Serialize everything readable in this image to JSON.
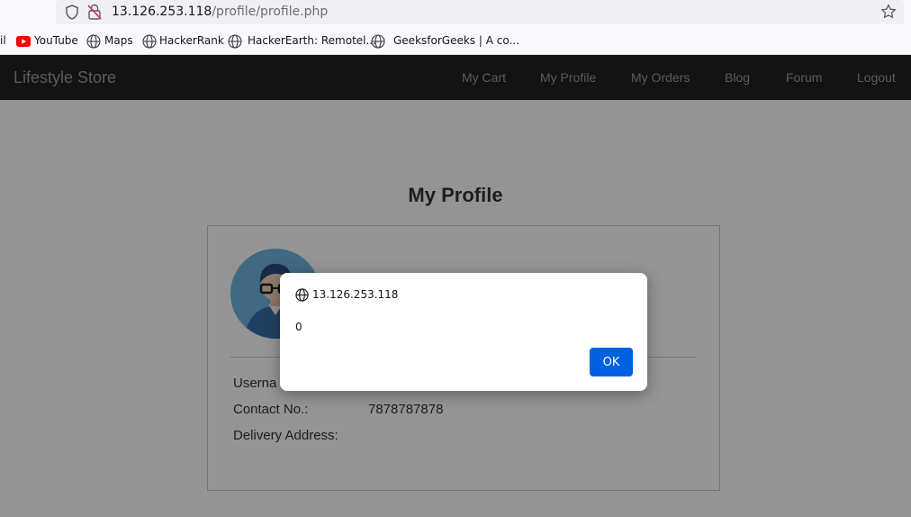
{
  "browser": {
    "url_host": "13.126.253.118",
    "url_path": "/profile/profile.php",
    "bookmarks": [
      {
        "label": "il",
        "icon": "gmail-icon"
      },
      {
        "label": "YouTube",
        "icon": "youtube-icon"
      },
      {
        "label": "Maps",
        "icon": "globe-icon"
      },
      {
        "label": "HackerRank",
        "icon": "globe-icon"
      },
      {
        "label": "HackerEarth: Remotel...",
        "icon": "globe-icon"
      },
      {
        "label": "GeeksforGeeks | A co...",
        "icon": "globe-icon"
      }
    ],
    "youtube_color": "#ff0000"
  },
  "site": {
    "brand": "Lifestyle Store",
    "nav": [
      "My Cart",
      "My Profile",
      "My Orders",
      "Blog",
      "Forum",
      "Logout"
    ]
  },
  "profile": {
    "title": "My Profile",
    "username_label": "Userna",
    "contact_label": "Contact No.:",
    "contact_value": "7878787878",
    "address_label": "Delivery Address:"
  },
  "dialog": {
    "origin": "13.126.253.118",
    "message": "0",
    "ok_label": "OK",
    "accent": "#0061e0"
  }
}
